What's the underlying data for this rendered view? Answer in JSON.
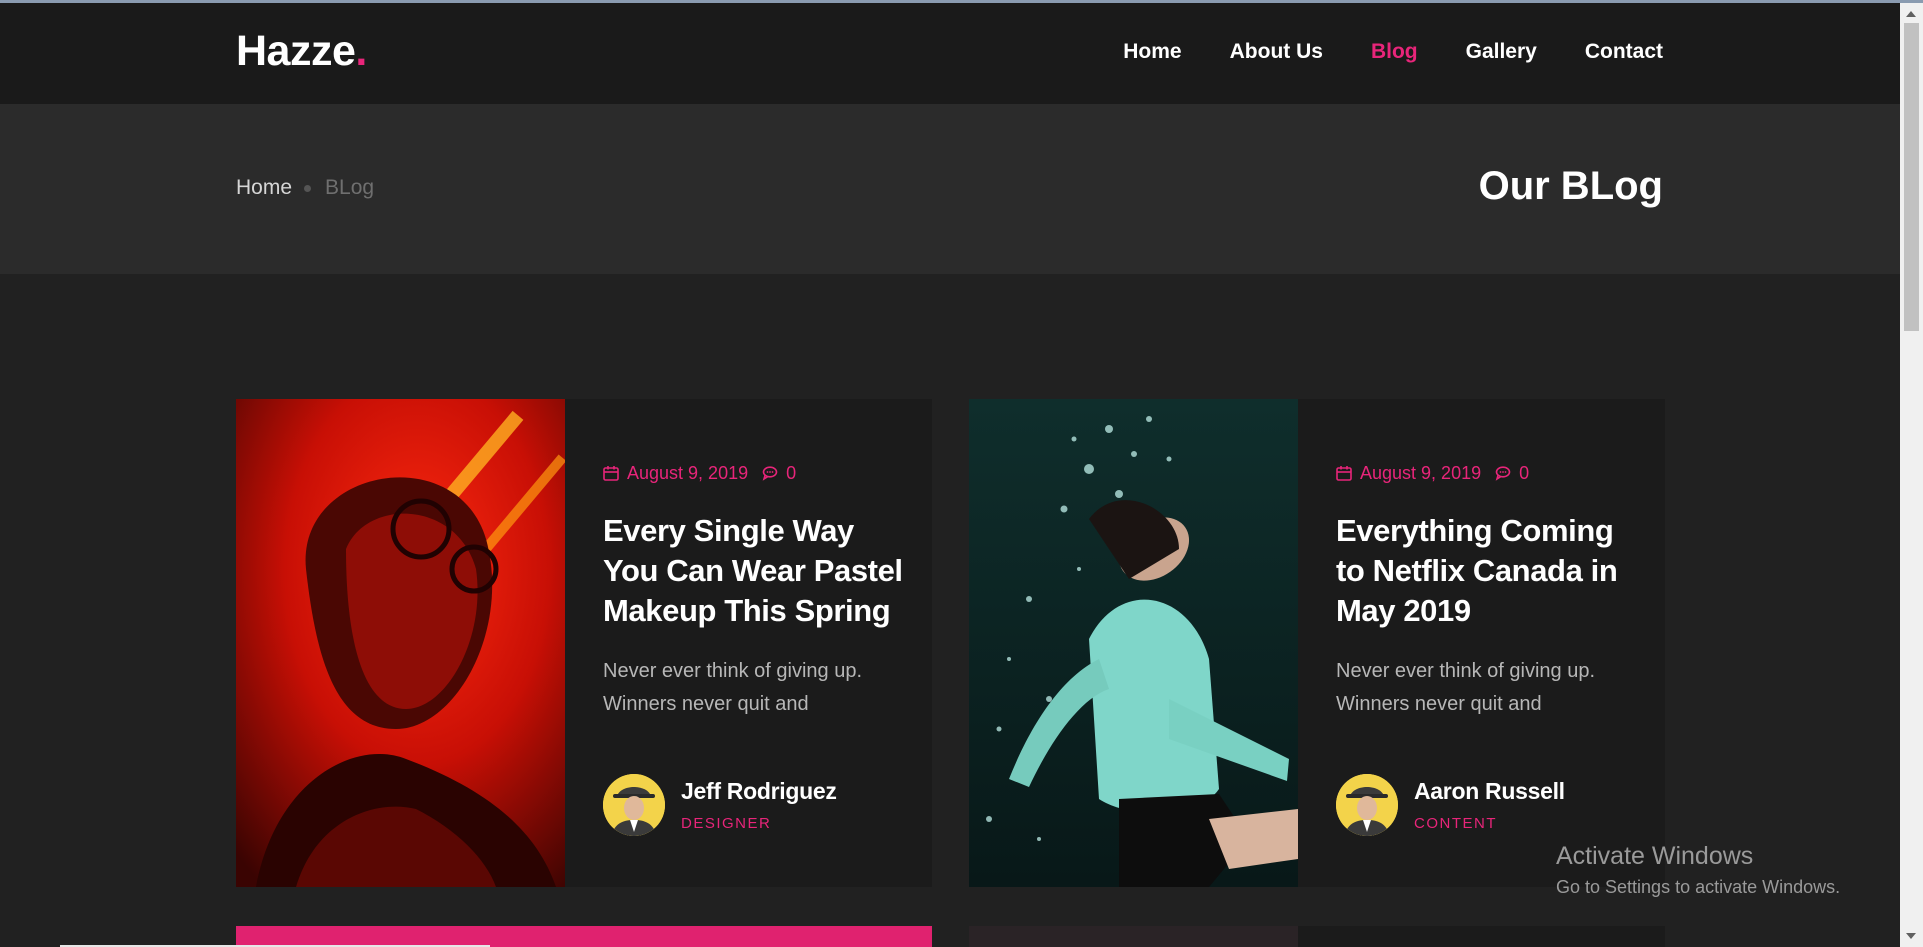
{
  "header": {
    "logo_text": "Hazze",
    "logo_dot": ".",
    "nav": [
      {
        "label": "Home"
      },
      {
        "label": "About Us"
      },
      {
        "label": "Blog"
      },
      {
        "label": "Gallery"
      },
      {
        "label": "Contact"
      }
    ],
    "active_nav": "Blog"
  },
  "banner": {
    "breadcrumb_home": "Home",
    "breadcrumb_current": "BLog",
    "title": "Our BLog"
  },
  "posts": [
    {
      "date": "August 9, 2019",
      "comments": "0",
      "title": "Every Single Way You Can Wear Pastel Makeup This Spring",
      "excerpt": "Never ever think of giving up. Winners never quit and",
      "author_name": "Jeff Rodriguez",
      "author_role": "DESIGNER"
    },
    {
      "date": "August 9, 2019",
      "comments": "0",
      "title": "Everything Coming to Netflix Canada in May 2019",
      "excerpt": "Never ever think of giving up. Winners never quit and",
      "author_name": "Aaron Russell",
      "author_role": "CONTENT"
    }
  ],
  "watermark": {
    "line1": "Activate Windows",
    "line2": "Go to Settings to activate Windows."
  },
  "colors": {
    "accent": "#e8257a",
    "header_bg": "#1a1a1a",
    "banner_bg": "#2b2b2b",
    "page_bg": "#212121",
    "card_bg": "#1b1b1b"
  }
}
